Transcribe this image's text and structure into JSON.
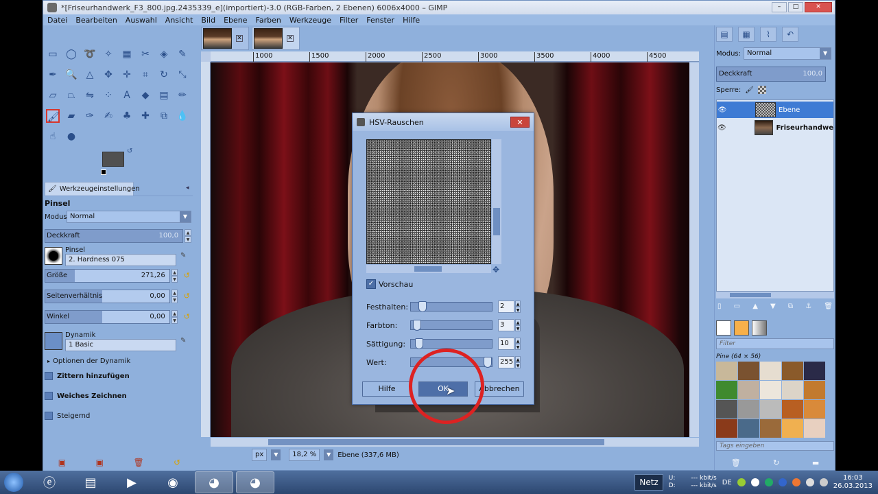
{
  "window": {
    "title": "*[Friseurhandwerk_F3_800.jpg.2435339_e](importiert)-3.0 (RGB-Farben, 2 Ebenen) 6006x4000 – GIMP"
  },
  "menu": [
    "Datei",
    "Bearbeiten",
    "Auswahl",
    "Ansicht",
    "Bild",
    "Ebene",
    "Farben",
    "Werkzeuge",
    "Filter",
    "Fenster",
    "Hilfe"
  ],
  "tool_options": {
    "tab_label": "Werkzeugeinstellungen",
    "heading": "Pinsel",
    "mode_label": "Modus:",
    "mode_value": "Normal",
    "opacity_label": "Deckkraft",
    "opacity_value": "100,0",
    "brush_label": "Pinsel",
    "brush_value": "2. Hardness 075",
    "size_label": "Größe",
    "size_value": "271,26",
    "aspect_label": "Seitenverhältnis",
    "aspect_value": "0,00",
    "angle_label": "Winkel",
    "angle_value": "0,00",
    "dynamics_label": "Dynamik",
    "dynamics_value": "1 Basic",
    "dynamics_options": "Optionen der Dynamik",
    "jitter": "Zittern hinzufügen",
    "smooth": "Weiches Zeichnen",
    "incremental": "Steigernd"
  },
  "ruler_ticks": [
    "1000",
    "1500",
    "2000",
    "2500",
    "3000",
    "3500",
    "4000",
    "4500"
  ],
  "statusbar": {
    "unit": "px",
    "zoom": "18,2 %",
    "info": "Ebene (337,6 MB)"
  },
  "dialog": {
    "title": "HSV-Rauschen",
    "preview_label": "Vorschau",
    "params": [
      {
        "label": "Festhalten:",
        "value": "2",
        "fraction": 0.1
      },
      {
        "label": "Farbton:",
        "value": "3",
        "fraction": 0.03
      },
      {
        "label": "Sättigung:",
        "value": "10",
        "fraction": 0.06
      },
      {
        "label": "Wert:",
        "value": "255",
        "fraction": 1.0
      }
    ],
    "help_button": "Hilfe",
    "ok_button": "OK",
    "cancel_button": "Abbrechen"
  },
  "layers": {
    "mode_label": "Modus:",
    "mode_value": "Normal",
    "opacity_label": "Deckkraft",
    "opacity_value": "100,0",
    "lock_label": "Sperre:",
    "items": [
      {
        "name": "Ebene"
      },
      {
        "name": "Friseurhandwe"
      }
    ]
  },
  "brushes": {
    "filter_placeholder": "Filter",
    "pattern_label": "Pine (64 × 56)",
    "tags_placeholder": "Tags eingeben"
  },
  "taskbar": {
    "network_label": "Netz",
    "up_label": "U:",
    "down_label": "D:",
    "up_rate": "--- kbit/s",
    "down_rate": "--- kbit/s",
    "lang": "DE",
    "time": "16:03",
    "date": "26.03.2013"
  },
  "colors": {
    "accent": "#3e7bd4",
    "window_bg": "#8fb0dc",
    "highlight_circle": "#dd2222"
  }
}
